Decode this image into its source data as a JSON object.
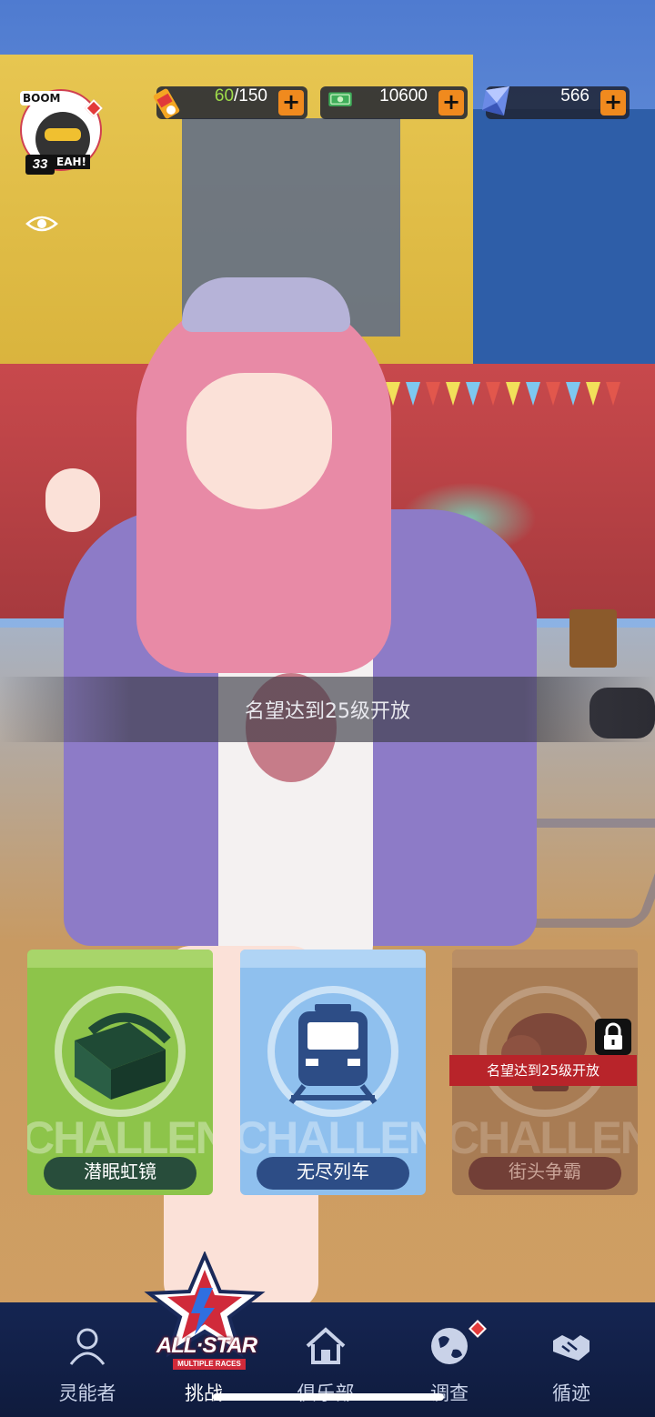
{
  "hud": {
    "level": "33",
    "avatar_boom": "BOOM",
    "avatar_yeah": "EAH!",
    "stamina": {
      "current": "60",
      "sep_max": "/150"
    },
    "cash": "10600",
    "crystal": "566",
    "plus": "+"
  },
  "banner": {
    "text": "名望达到25级开放"
  },
  "cards": [
    {
      "label": "潜眠虹镜",
      "watermark": "CHALLENGE",
      "locked": false
    },
    {
      "label": "无尽列车",
      "watermark": "CHALLENGE",
      "locked": false
    },
    {
      "label": "街头争霸",
      "watermark": "CHALLENGE",
      "locked": true,
      "lock_text": "名望达到25级开放"
    }
  ],
  "allstar": {
    "title": "ALL·STAR",
    "subtitle": "MULTIPLE RACES"
  },
  "nav": {
    "items": [
      {
        "label": "灵能者",
        "icon": "person-icon"
      },
      {
        "label": "挑战",
        "icon": "allstar-logo"
      },
      {
        "label": "俱乐部",
        "icon": "home-icon"
      },
      {
        "label": "调查",
        "icon": "globe-icon"
      },
      {
        "label": "循迹",
        "icon": "handshake-icon"
      }
    ]
  },
  "colors": {
    "accent_orange": "#f08a1e",
    "card_green": "#8dc44a",
    "card_blue": "#8fc0ee",
    "card_locked": "#a77b54",
    "nav_bg": "#152552",
    "alert_red": "#e33a3a"
  }
}
